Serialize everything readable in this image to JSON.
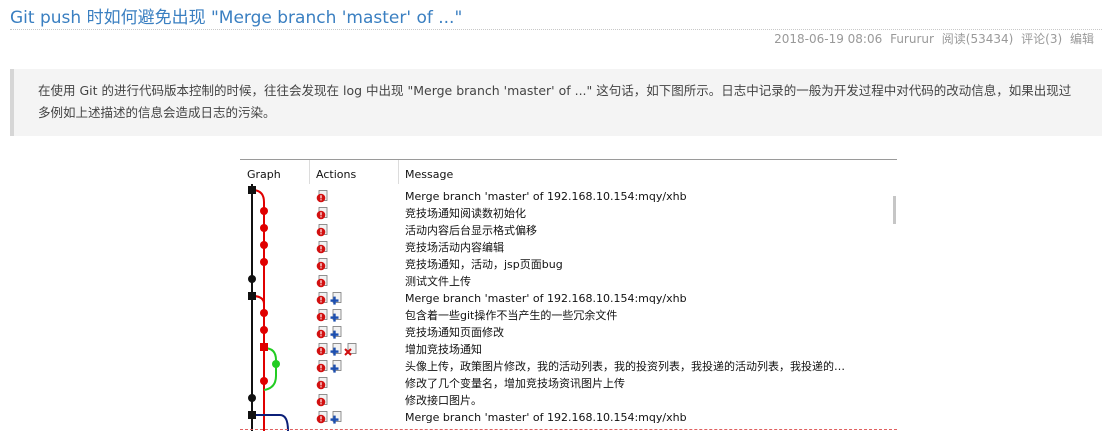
{
  "post": {
    "title": "Git push 时如何避免出现 \"Merge branch 'master' of ...\"",
    "date": "2018-06-19 08:06",
    "author": "Fururur",
    "reads": "阅读(53434)",
    "comments": "评论(3)",
    "edit": "编辑"
  },
  "intro": {
    "line1": "在使用 Git 的进行代码版本控制的时候，往往会发现在 log 中出现 \"Merge branch 'master' of ...\" 这句话，如下图所示。日志中记录的一般为开发过程中对代码的改动信息，如果出现过",
    "line2": "多例如上述描述的信息会造成日志的污染。"
  },
  "gitlog": {
    "columns": {
      "graph": "Graph",
      "actions": "Actions",
      "message": "Message"
    },
    "rows": [
      {
        "message": "Merge branch 'master' of 192.168.10.154:mqy/xhb",
        "actions": [
          "push"
        ]
      },
      {
        "message": "竞技场通知阅读数初始化",
        "actions": [
          "push"
        ]
      },
      {
        "message": "活动内容后台显示格式偏移",
        "actions": [
          "push"
        ]
      },
      {
        "message": "竞技场活动内容编辑",
        "actions": [
          "push"
        ]
      },
      {
        "message": "竞技场通知，活动，jsp页面bug",
        "actions": [
          "push"
        ]
      },
      {
        "message": "测试文件上传",
        "actions": [
          "push"
        ]
      },
      {
        "message": "Merge branch 'master' of 192.168.10.154:mqy/xhb",
        "actions": [
          "push",
          "branch"
        ]
      },
      {
        "message": "包含着一些git操作不当产生的一些冗余文件",
        "actions": [
          "push",
          "branch"
        ]
      },
      {
        "message": "竞技场通知页面修改",
        "actions": [
          "push",
          "branch"
        ]
      },
      {
        "message": "增加竞技场通知",
        "actions": [
          "push",
          "branch",
          "delete"
        ]
      },
      {
        "message": "头像上传，政策图片修改，我的活动列表，我的投资列表，我投递的活动列表，我投递的…",
        "actions": [
          "push",
          "branch"
        ]
      },
      {
        "message": "修改了几个变量名，增加竞技场资讯图片上传",
        "actions": [
          "push"
        ]
      },
      {
        "message": "修改接口图片。",
        "actions": [
          "push"
        ]
      },
      {
        "message": "Merge branch 'master' of 192.168.10.154:mqy/xhb",
        "actions": [
          "push",
          "branch"
        ]
      }
    ]
  },
  "colors": {
    "title_link": "#3a7fc1",
    "graph_black": "#111111",
    "graph_red": "#e00000",
    "graph_green": "#22cc22",
    "graph_navy": "#0b1f78"
  }
}
